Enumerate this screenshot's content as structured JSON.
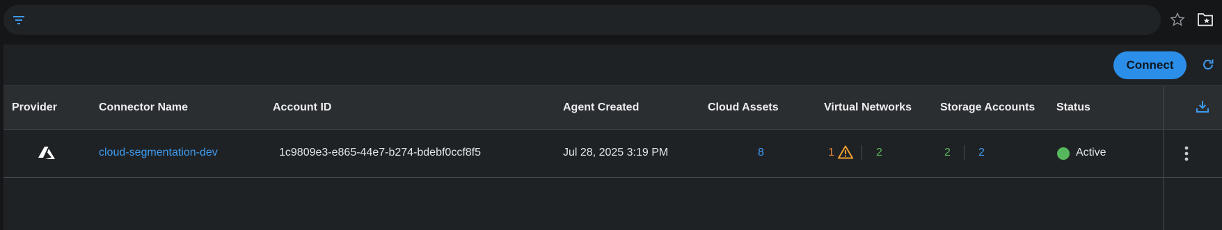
{
  "filter_bar": {
    "icon": "filter-icon"
  },
  "toolbar": {
    "connect_label": "Connect"
  },
  "colors": {
    "accent": "#2b8fea",
    "active": "#56b85c",
    "warning": "#e6843a"
  },
  "table": {
    "headers": {
      "provider": "Provider",
      "connector_name": "Connector Name",
      "account_id": "Account ID",
      "agent_created": "Agent Created",
      "cloud_assets": "Cloud Assets",
      "virtual_networks": "Virtual Networks",
      "storage_accounts": "Storage Accounts",
      "status": "Status"
    },
    "rows": [
      {
        "provider_icon": "azure-logo-icon",
        "connector_name": "cloud-segmentation-dev",
        "account_id": "1c9809e3-e865-44e7-b274-bdebf0ccf8f5",
        "agent_created": "Jul 28, 2025 3:19 PM",
        "cloud_assets": "8",
        "virtual_networks_warning": "1",
        "virtual_networks_ok": "2",
        "storage_accounts_a": "2",
        "storage_accounts_b": "2",
        "status": "Active"
      }
    ]
  }
}
